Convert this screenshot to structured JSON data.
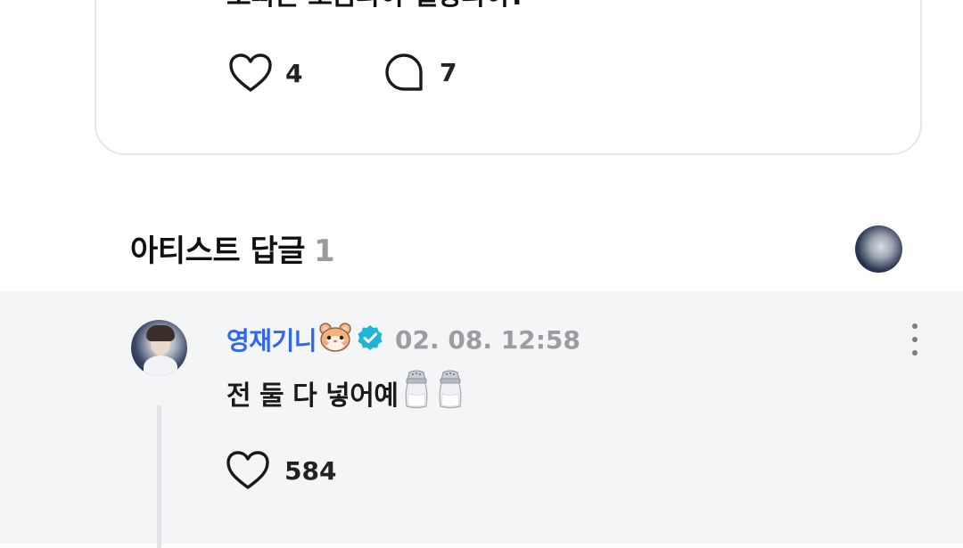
{
  "post": {
    "text": "오빠는 소금파야 설탕파야?",
    "likes": "4",
    "replies": "7"
  },
  "artist_replies": {
    "title": "아티스트 답글",
    "count": "1"
  },
  "comment": {
    "author": "영재기니",
    "timestamp": "02. 08. 12:58",
    "text": "전 둘 다 넣어예",
    "likes": "584"
  },
  "icons": {
    "like": "heart-outline-icon",
    "reply": "speech-bubble-icon",
    "verified": "verified-badge-icon",
    "emoji": "hamster-face-icon",
    "salt": "salt-shaker-icon",
    "more": "more-vertical-icon"
  },
  "colors": {
    "author_name": "#3366ee",
    "verified_badge": "#1fb5d6",
    "timestamp": "#9c9ca1",
    "reply_count": "#9a9a9f",
    "comment_background": "#f4f5f7",
    "card_border": "#e6e6ea"
  }
}
